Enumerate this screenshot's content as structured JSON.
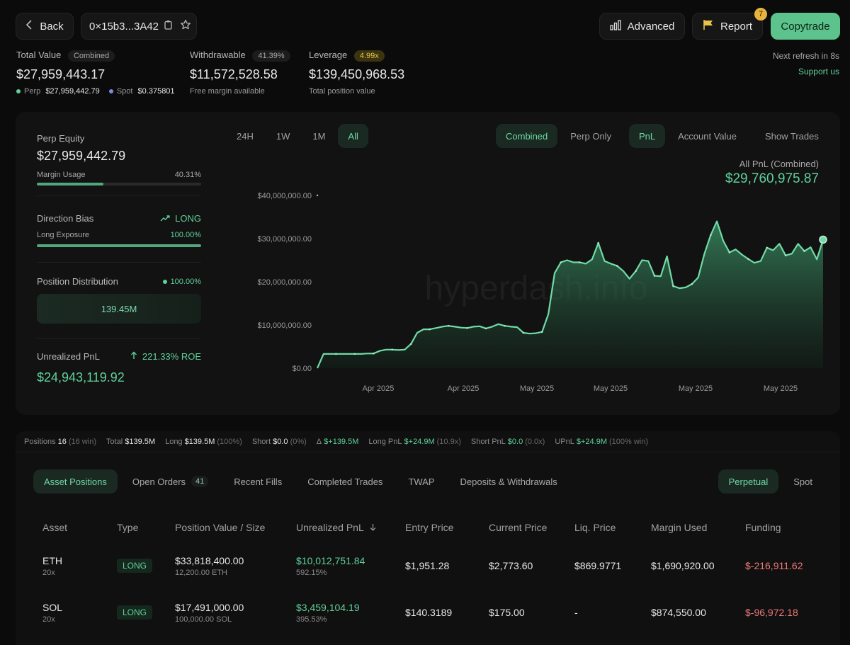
{
  "header": {
    "back_label": "Back",
    "address": "0×15b3...3A42",
    "advanced_label": "Advanced",
    "report_label": "Report",
    "report_badge": "7",
    "copytrade_label": "Copytrade",
    "next_refresh": "Next refresh in 8s",
    "support": "Support us"
  },
  "summary": {
    "total_value_label": "Total Value",
    "total_value_tag": "Combined",
    "total_value": "$27,959,443.17",
    "perp_label": "Perp",
    "perp_value": "$27,959,442.79",
    "spot_label": "Spot",
    "spot_value": "$0.375801",
    "withdrawable_label": "Withdrawable",
    "withdrawable_pct": "41.39%",
    "withdrawable_value": "$11,572,528.58",
    "withdrawable_sub": "Free margin available",
    "leverage_label": "Leverage",
    "leverage_tag": "4.99x",
    "leverage_value": "$139,450,968.53",
    "leverage_sub": "Total position value"
  },
  "side": {
    "perp_equity_label": "Perp Equity",
    "perp_equity": "$27,959,442.79",
    "margin_usage_label": "Margin Usage",
    "margin_usage_pct": "40.31%",
    "margin_usage_fraction": 0.4031,
    "direction_label": "Direction Bias",
    "direction_value": "LONG",
    "long_exposure_label": "Long Exposure",
    "long_exposure_pct": "100.00%",
    "long_exposure_fraction": 1.0,
    "distribution_label": "Position Distribution",
    "distribution_pct": "100.00%",
    "distribution_value": "139.45M",
    "unrealized_label": "Unrealized PnL",
    "roe": "221.33% ROE",
    "unrealized_value": "$24,943,119.92"
  },
  "chart_controls": {
    "ranges": [
      "24H",
      "1W",
      "1M",
      "All"
    ],
    "active_range": "All",
    "mode": [
      "Combined",
      "Perp Only"
    ],
    "active_mode": "Combined",
    "metric": [
      "PnL",
      "Account Value"
    ],
    "active_metric": "PnL",
    "show_trades": "Show Trades"
  },
  "chart_data": {
    "type": "area",
    "summary_label": "All PnL (Combined)",
    "summary_value": "$29,760,975.87",
    "watermark": "hyperdash.info",
    "yticks": [
      "$40,000,000.00",
      "$30,000,000.00",
      "$20,000,000.00",
      "$10,000,000.00",
      "$0.00"
    ],
    "ylim": [
      0,
      40000000
    ],
    "xticks": [
      "Apr 2025",
      "Apr 2025",
      "May 2025",
      "May 2025",
      "May 2025",
      "May 2025"
    ],
    "values": [
      0,
      3300000,
      3300000,
      3300000,
      3300000,
      3300000,
      3300000,
      3300000,
      3400000,
      3400000,
      4000000,
      4300000,
      4300000,
      4200000,
      4300000,
      5600000,
      8200000,
      9000000,
      9000000,
      9300000,
      9600000,
      9800000,
      9600000,
      9400000,
      9300000,
      9600000,
      9700000,
      9200000,
      9600000,
      10200000,
      9800000,
      9600000,
      9500000,
      8200000,
      8000000,
      8100000,
      8400000,
      12500000,
      22000000,
      24500000,
      25000000,
      24500000,
      24500000,
      24200000,
      25200000,
      29000000,
      24800000,
      24200000,
      23700000,
      22500000,
      20700000,
      22500000,
      25000000,
      24800000,
      21400000,
      21300000,
      25900000,
      19000000,
      18500000,
      18700000,
      19500000,
      21000000,
      26500000,
      30800000,
      34000000,
      29500000,
      26800000,
      27500000,
      26300000,
      25300000,
      24400000,
      24800000,
      27900000,
      27300000,
      28800000,
      26100000,
      26500000,
      28800000,
      27100000,
      28000000,
      25200000,
      29760975
    ]
  },
  "stats": {
    "positions_label": "Positions",
    "positions": "16",
    "positions_sub": "(16 win)",
    "total_label": "Total",
    "total": "$139.5M",
    "long_label": "Long",
    "long": "$139.5M",
    "long_sub": "(100%)",
    "short_label": "Short",
    "short": "$0.0",
    "short_sub": "(0%)",
    "delta_label": "Δ",
    "delta": "$+139.5M",
    "longpnl_label": "Long PnL",
    "longpnl": "$+24.9M",
    "longpnl_sub": "(10.9x)",
    "shortpnl_label": "Short PnL",
    "shortpnl": "$0.0",
    "shortpnl_sub": "(0.0x)",
    "upnl_label": "UPnL",
    "upnl": "$+24.9M",
    "upnl_sub": "(100% win)"
  },
  "tabs": {
    "asset_positions": "Asset Positions",
    "open_orders": "Open Orders",
    "open_orders_count": "41",
    "recent_fills": "Recent Fills",
    "completed_trades": "Completed Trades",
    "twap": "TWAP",
    "deposits": "Deposits & Withdrawals",
    "perpetual": "Perpetual",
    "spot": "Spot"
  },
  "table": {
    "headers": {
      "asset": "Asset",
      "type": "Type",
      "value": "Position Value / Size",
      "upnl": "Unrealized PnL",
      "entry": "Entry Price",
      "current": "Current Price",
      "liq": "Liq. Price",
      "margin": "Margin Used",
      "funding": "Funding"
    },
    "rows": [
      {
        "asset": "ETH",
        "lev": "20x",
        "type": "LONG",
        "value": "$33,818,400.00",
        "size": "12,200.00 ETH",
        "upnl": "$10,012,751.84",
        "upnl_pct": "592.15%",
        "entry": "$1,951.28",
        "current": "$2,773.60",
        "liq": "$869.9771",
        "margin": "$1,690,920.00",
        "funding": "$-216,911.62"
      },
      {
        "asset": "SOL",
        "lev": "20x",
        "type": "LONG",
        "value": "$17,491,000.00",
        "size": "100,000.00 SOL",
        "upnl": "$3,459,104.19",
        "upnl_pct": "395.53%",
        "entry": "$140.3189",
        "current": "$175.00",
        "liq": "-",
        "margin": "$874,550.00",
        "funding": "$-96,972.18"
      }
    ]
  },
  "colors": {
    "accent": "#5fd19b",
    "negative": "#f07878",
    "warning": "#e8c549",
    "copytrade": "#5cc38d"
  }
}
